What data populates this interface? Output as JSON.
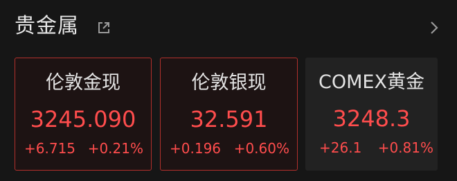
{
  "section": {
    "title": "贵金属"
  },
  "icons": {
    "share": "share-external-icon",
    "more": "chevron-right-icon"
  },
  "colors": {
    "up": "#ff4d4d",
    "highlight_border": "#b3302c",
    "background": "#161616"
  },
  "cards": [
    {
      "name": "伦敦金现",
      "price": "3245.090",
      "change": "+6.715",
      "percent": "+0.21%"
    },
    {
      "name": "伦敦银现",
      "price": "32.591",
      "change": "+0.196",
      "percent": "+0.60%"
    },
    {
      "name": "COMEX黄金",
      "price": "3248.3",
      "change": "+26.1",
      "percent": "+0.81%"
    }
  ]
}
